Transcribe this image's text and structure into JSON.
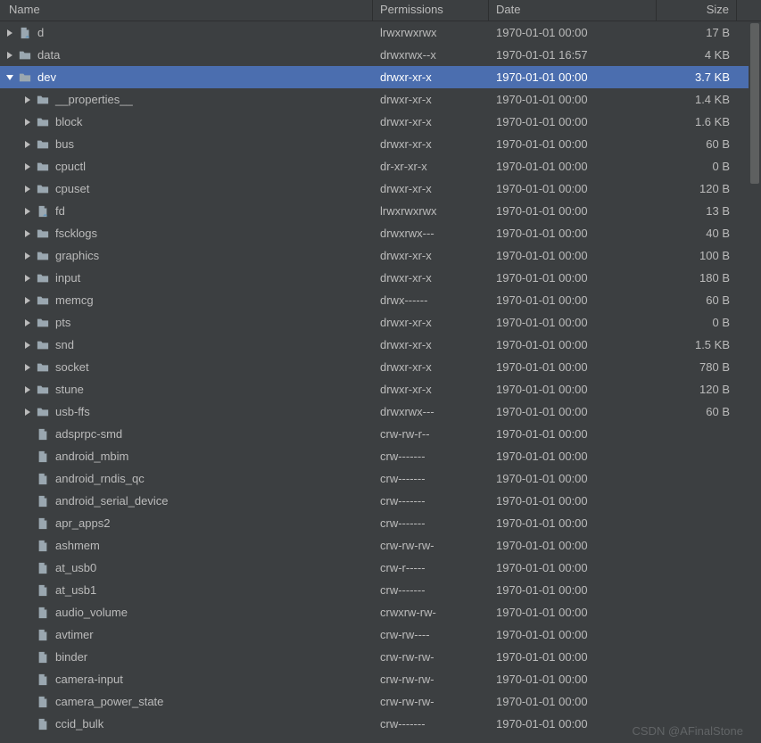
{
  "columns": {
    "name": "Name",
    "permissions": "Permissions",
    "date": "Date",
    "size": "Size"
  },
  "rows": [
    {
      "depth": 0,
      "expand": "closed",
      "icon": "link",
      "name": "d",
      "perm": "lrwxrwxrwx",
      "date": "1970-01-01 00:00",
      "size": "17 B"
    },
    {
      "depth": 0,
      "expand": "closed",
      "icon": "folder",
      "name": "data",
      "perm": "drwxrwx--x",
      "date": "1970-01-01 16:57",
      "size": "4 KB"
    },
    {
      "depth": 0,
      "expand": "open",
      "icon": "folder",
      "name": "dev",
      "selected": true,
      "perm": "drwxr-xr-x",
      "date": "1970-01-01 00:00",
      "size": "3.7 KB"
    },
    {
      "depth": 1,
      "expand": "closed",
      "icon": "folder",
      "name": "__properties__",
      "perm": "drwxr-xr-x",
      "date": "1970-01-01 00:00",
      "size": "1.4 KB"
    },
    {
      "depth": 1,
      "expand": "closed",
      "icon": "folder",
      "name": "block",
      "perm": "drwxr-xr-x",
      "date": "1970-01-01 00:00",
      "size": "1.6 KB"
    },
    {
      "depth": 1,
      "expand": "closed",
      "icon": "folder",
      "name": "bus",
      "perm": "drwxr-xr-x",
      "date": "1970-01-01 00:00",
      "size": "60 B"
    },
    {
      "depth": 1,
      "expand": "closed",
      "icon": "folder",
      "name": "cpuctl",
      "perm": "dr-xr-xr-x",
      "date": "1970-01-01 00:00",
      "size": "0 B"
    },
    {
      "depth": 1,
      "expand": "closed",
      "icon": "folder",
      "name": "cpuset",
      "perm": "drwxr-xr-x",
      "date": "1970-01-01 00:00",
      "size": "120 B"
    },
    {
      "depth": 1,
      "expand": "closed",
      "icon": "link",
      "name": "fd",
      "perm": "lrwxrwxrwx",
      "date": "1970-01-01 00:00",
      "size": "13 B"
    },
    {
      "depth": 1,
      "expand": "closed",
      "icon": "folder",
      "name": "fscklogs",
      "perm": "drwxrwx---",
      "date": "1970-01-01 00:00",
      "size": "40 B"
    },
    {
      "depth": 1,
      "expand": "closed",
      "icon": "folder",
      "name": "graphics",
      "perm": "drwxr-xr-x",
      "date": "1970-01-01 00:00",
      "size": "100 B"
    },
    {
      "depth": 1,
      "expand": "closed",
      "icon": "folder",
      "name": "input",
      "perm": "drwxr-xr-x",
      "date": "1970-01-01 00:00",
      "size": "180 B"
    },
    {
      "depth": 1,
      "expand": "closed",
      "icon": "folder",
      "name": "memcg",
      "perm": "drwx------",
      "date": "1970-01-01 00:00",
      "size": "60 B"
    },
    {
      "depth": 1,
      "expand": "closed",
      "icon": "folder",
      "name": "pts",
      "perm": "drwxr-xr-x",
      "date": "1970-01-01 00:00",
      "size": "0 B"
    },
    {
      "depth": 1,
      "expand": "closed",
      "icon": "folder",
      "name": "snd",
      "perm": "drwxr-xr-x",
      "date": "1970-01-01 00:00",
      "size": "1.5 KB"
    },
    {
      "depth": 1,
      "expand": "closed",
      "icon": "folder",
      "name": "socket",
      "perm": "drwxr-xr-x",
      "date": "1970-01-01 00:00",
      "size": "780 B"
    },
    {
      "depth": 1,
      "expand": "closed",
      "icon": "folder",
      "name": "stune",
      "perm": "drwxr-xr-x",
      "date": "1970-01-01 00:00",
      "size": "120 B"
    },
    {
      "depth": 1,
      "expand": "closed",
      "icon": "folder",
      "name": "usb-ffs",
      "perm": "drwxrwx---",
      "date": "1970-01-01 00:00",
      "size": "60 B"
    },
    {
      "depth": 1,
      "expand": "none",
      "icon": "file",
      "name": "adsprpc-smd",
      "perm": "crw-rw-r--",
      "date": "1970-01-01 00:00",
      "size": ""
    },
    {
      "depth": 1,
      "expand": "none",
      "icon": "file",
      "name": "android_mbim",
      "perm": "crw-------",
      "date": "1970-01-01 00:00",
      "size": ""
    },
    {
      "depth": 1,
      "expand": "none",
      "icon": "file",
      "name": "android_rndis_qc",
      "perm": "crw-------",
      "date": "1970-01-01 00:00",
      "size": ""
    },
    {
      "depth": 1,
      "expand": "none",
      "icon": "file",
      "name": "android_serial_device",
      "perm": "crw-------",
      "date": "1970-01-01 00:00",
      "size": ""
    },
    {
      "depth": 1,
      "expand": "none",
      "icon": "file",
      "name": "apr_apps2",
      "perm": "crw-------",
      "date": "1970-01-01 00:00",
      "size": ""
    },
    {
      "depth": 1,
      "expand": "none",
      "icon": "file",
      "name": "ashmem",
      "perm": "crw-rw-rw-",
      "date": "1970-01-01 00:00",
      "size": ""
    },
    {
      "depth": 1,
      "expand": "none",
      "icon": "file",
      "name": "at_usb0",
      "perm": "crw-r-----",
      "date": "1970-01-01 00:00",
      "size": ""
    },
    {
      "depth": 1,
      "expand": "none",
      "icon": "file",
      "name": "at_usb1",
      "perm": "crw-------",
      "date": "1970-01-01 00:00",
      "size": ""
    },
    {
      "depth": 1,
      "expand": "none",
      "icon": "file",
      "name": "audio_volume",
      "perm": "crwxrw-rw-",
      "date": "1970-01-01 00:00",
      "size": ""
    },
    {
      "depth": 1,
      "expand": "none",
      "icon": "file",
      "name": "avtimer",
      "perm": "crw-rw----",
      "date": "1970-01-01 00:00",
      "size": ""
    },
    {
      "depth": 1,
      "expand": "none",
      "icon": "file",
      "name": "binder",
      "perm": "crw-rw-rw-",
      "date": "1970-01-01 00:00",
      "size": ""
    },
    {
      "depth": 1,
      "expand": "none",
      "icon": "file",
      "name": "camera-input",
      "perm": "crw-rw-rw-",
      "date": "1970-01-01 00:00",
      "size": ""
    },
    {
      "depth": 1,
      "expand": "none",
      "icon": "file",
      "name": "camera_power_state",
      "perm": "crw-rw-rw-",
      "date": "1970-01-01 00:00",
      "size": ""
    },
    {
      "depth": 1,
      "expand": "none",
      "icon": "file",
      "name": "ccid_bulk",
      "perm": "crw-------",
      "date": "1970-01-01 00:00",
      "size": ""
    }
  ],
  "watermark": "CSDN @AFinalStone"
}
